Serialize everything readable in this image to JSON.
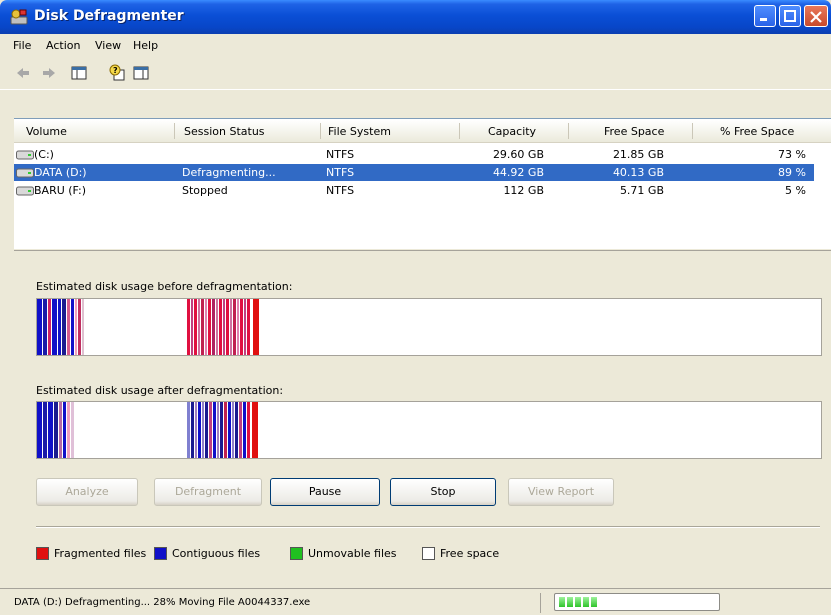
{
  "window": {
    "title": "Disk Defragmenter"
  },
  "menu": [
    "File",
    "Action",
    "View",
    "Help"
  ],
  "columns": [
    "Volume",
    "Session Status",
    "File System",
    "Capacity",
    "Free Space",
    "% Free Space"
  ],
  "volumes": [
    {
      "volume": "(C:)",
      "status": "",
      "fs": "NTFS",
      "capacity": "29.60 GB",
      "free": "21.85 GB",
      "pct": "73 %"
    },
    {
      "volume": "DATA (D:)",
      "status": "Defragmenting...",
      "fs": "NTFS",
      "capacity": "44.92 GB",
      "free": "40.13 GB",
      "pct": "89 %"
    },
    {
      "volume": "BARU (F:)",
      "status": "Stopped",
      "fs": "NTFS",
      "capacity": "112 GB",
      "free": "5.71 GB",
      "pct": "5 %"
    }
  ],
  "labels": {
    "before": "Estimated disk usage before defragmentation:",
    "after": "Estimated disk usage after defragmentation:"
  },
  "buttons": {
    "analyze": "Analyze",
    "defragment": "Defragment",
    "pause": "Pause",
    "stop": "Stop",
    "view_report": "View Report"
  },
  "legend": [
    {
      "label": "Fragmented files",
      "color": "#e01010"
    },
    {
      "label": "Contiguous files",
      "color": "#1010c8"
    },
    {
      "label": "Unmovable files",
      "color": "#20c020"
    },
    {
      "label": "Free space",
      "color": "#ffffff"
    }
  ],
  "status": {
    "text": "DATA (D:) Defragmenting... 28%  Moving File A0044337.exe",
    "progress": 0.28
  },
  "colors": {
    "titlebar": "#0a4fd6",
    "selection": "#316ac5",
    "fragmented": "#e01010",
    "contiguous": "#1010c8"
  }
}
